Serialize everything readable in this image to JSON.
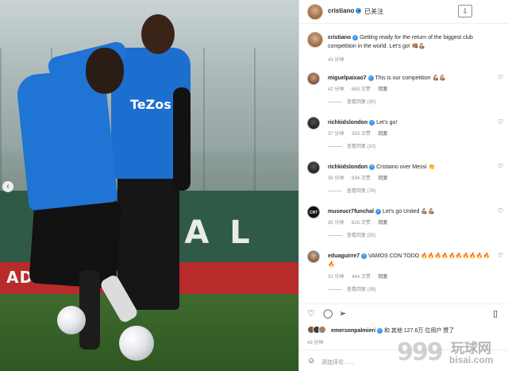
{
  "photo": {
    "wall_text": "B   A   L",
    "board_text": "ADIDAS.COM",
    "sponsor_text": "TeZos",
    "nav_arrow": "‹"
  },
  "header": {
    "username": "cristiano",
    "separator": "•",
    "follow_status": "已关注",
    "more_icon": "⇩"
  },
  "caption": {
    "username": "cristiano",
    "text": "Getting ready for the return of the biggest club competition in the world. Let's go! 👊🏽💪🏽",
    "time": "43 分钟"
  },
  "comments": [
    {
      "username": "miguelpaixao7",
      "verified": true,
      "text": "This is our competition 💪🏽💪🏽",
      "time": "42 分钟",
      "likes": "680 次赞",
      "reply": "回复",
      "view_replies": "查看回复 (30)"
    },
    {
      "username": "richkidslondon",
      "verified": true,
      "text": "Let's go!",
      "time": "37 分钟",
      "likes": "353 次赞",
      "reply": "回复",
      "view_replies": "查看回复 (10)"
    },
    {
      "username": "richkidslondon",
      "verified": true,
      "text": "Cristaino over Messi 👏",
      "time": "36 分钟",
      "likes": "934 次赞",
      "reply": "回复",
      "view_replies": "查看回复 (76)"
    },
    {
      "username": "museucr7funchal",
      "verified": true,
      "avatar_label": "CR7",
      "text": "Let's go United 💪🏽💪🏽",
      "time": "35 分钟",
      "likes": "615 次赞",
      "reply": "回复",
      "view_replies": "查看回复 (55)"
    },
    {
      "username": "eduaguirre7",
      "verified": true,
      "text": "VAMOS CON TODO 🔥🔥🔥🔥🔥🔥🔥🔥🔥🔥🔥",
      "time": "31 分钟",
      "likes": "444 次赞",
      "reply": "回复",
      "view_replies": "查看回复 (39)"
    }
  ],
  "actions": {
    "like_icon": "♡",
    "comment_icon": "◯",
    "share_icon": "➢",
    "save_icon": "▯"
  },
  "likes": {
    "liker": "emersonpalmieri",
    "text": " 和 其他 127.6万 位用户 赞了"
  },
  "post_time": "43 分钟",
  "add_comment": {
    "emoji_icon": "☺",
    "placeholder": "添加评论……"
  },
  "watermark": {
    "number": "999",
    "cn": "玩球网",
    "en": "bisai.com"
  }
}
